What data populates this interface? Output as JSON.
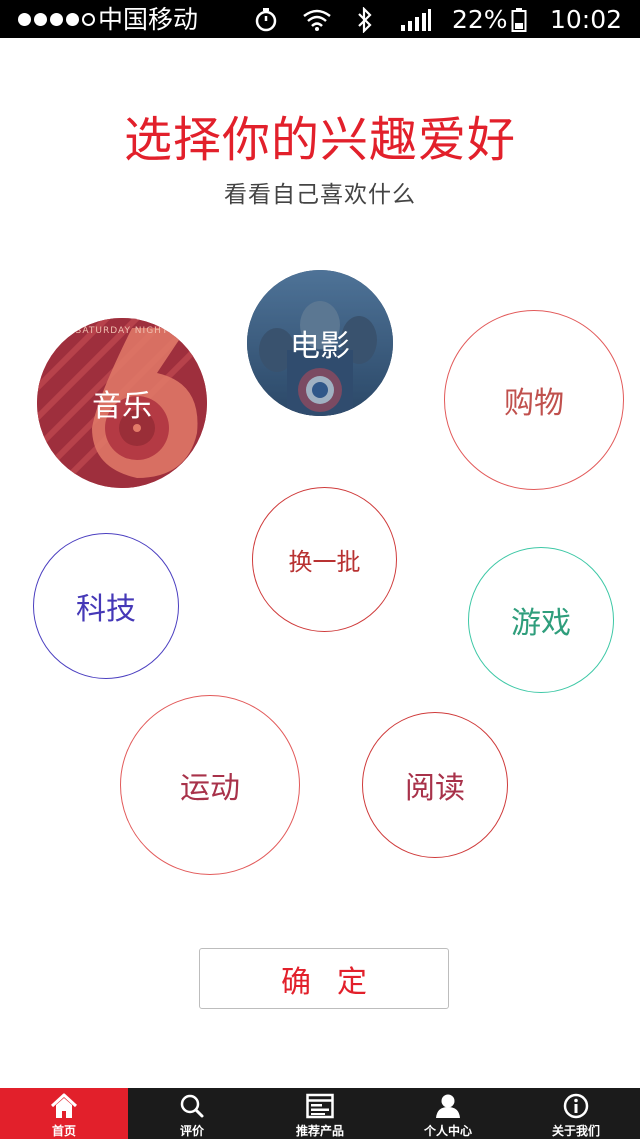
{
  "status_bar": {
    "carrier": "中国移动",
    "battery": "22%",
    "time": "10:02",
    "icons": [
      "timer-icon",
      "wifi-icon",
      "bluetooth-icon",
      "cellular-signal-icon",
      "battery-icon"
    ]
  },
  "header": {
    "title": "选择你的兴趣爱好",
    "subtitle": "看看自己喜欢什么"
  },
  "interests": {
    "music": "音乐",
    "movie": "电影",
    "shopping": "购物",
    "refresh": "换一批",
    "tech": "科技",
    "game": "游戏",
    "sport": "运动",
    "reading": "阅读",
    "music_poster_text": "SATURDAY NIGHT"
  },
  "confirm_button": "确定",
  "tabbar": {
    "items": [
      {
        "label": "首页",
        "icon": "home-icon",
        "active": true
      },
      {
        "label": "评价",
        "icon": "search-icon",
        "active": false
      },
      {
        "label": "推荐产品",
        "icon": "browser-icon",
        "active": false
      },
      {
        "label": "个人中心",
        "icon": "user-icon",
        "active": false
      },
      {
        "label": "关于我们",
        "icon": "info-icon",
        "active": false
      }
    ]
  },
  "colors": {
    "accent": "#e2202b",
    "tabbar_bg": "#1b1b1b",
    "tech_outline": "#4b3fc0",
    "game_outline": "#3ec8a6"
  }
}
